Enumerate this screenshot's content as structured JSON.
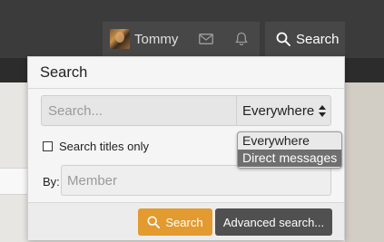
{
  "header": {
    "user_name": "Tommy",
    "search_label": "Search",
    "icons": {
      "avatar": "user-avatar",
      "mail": "envelope-icon",
      "bell": "bell-icon",
      "search": "search-icon"
    }
  },
  "popup": {
    "title": "Search",
    "search_input": {
      "value": "",
      "placeholder": "Search..."
    },
    "scope": {
      "selected": "Everywhere",
      "options": [
        "Everywhere",
        "Direct messages"
      ],
      "highlighted": "Direct messages"
    },
    "titles_only_label": "Search titles only",
    "titles_only_checked": false,
    "by_label": "By:",
    "member_input": {
      "value": "",
      "placeholder": "Member"
    },
    "search_button": "Search",
    "advanced_button": "Advanced search..."
  },
  "colors": {
    "accent": "#e39a2e",
    "header_bg": "#3b3b3b",
    "nav_button_bg": "#474747",
    "secondary_button_bg": "#505050"
  }
}
